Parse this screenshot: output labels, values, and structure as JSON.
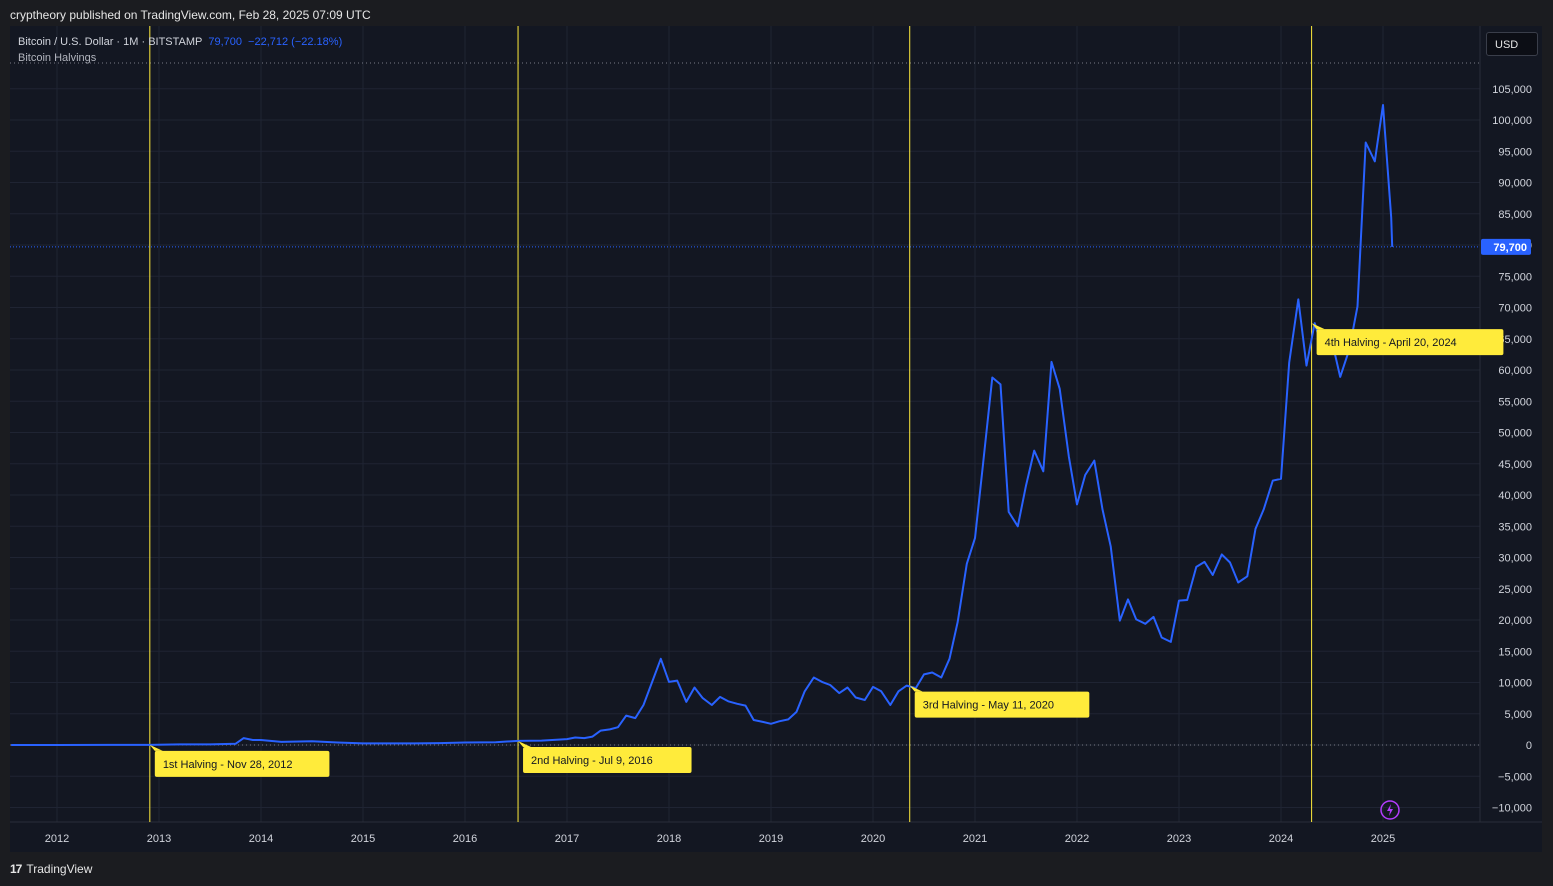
{
  "header": {
    "published": "cryptheory published on TradingView.com, Feb 28, 2025 07:09 UTC"
  },
  "legend": {
    "symbol": "Bitcoin / U.S. Dollar · 1M · BITSTAMP",
    "last": "79,700",
    "change": "−22,712 (−22.18%)",
    "indicator": "Bitcoin Halvings"
  },
  "currency_button": "USD",
  "footer": {
    "brand": "TradingView"
  },
  "colors": {
    "line": "#2962ff",
    "halving_line": "#ffeb3b",
    "label_bg": "#ffeb3b",
    "price_tag": "#2962ff"
  },
  "chart_data": {
    "type": "line",
    "x_ticks": [
      "2012",
      "2013",
      "2014",
      "2015",
      "2016",
      "2017",
      "2018",
      "2019",
      "2020",
      "2021",
      "2022",
      "2023",
      "2024",
      "2025"
    ],
    "y_ticks": [
      "105,000",
      "100,000",
      "95,000",
      "90,000",
      "85,000",
      "80,000",
      "75,000",
      "70,000",
      "65,000",
      "60,000",
      "55,000",
      "50,000",
      "45,000",
      "40,000",
      "35,000",
      "30,000",
      "25,000",
      "20,000",
      "15,000",
      "10,000",
      "5,000",
      "0",
      "−5,000",
      "−10,000"
    ],
    "ylim": [
      -12000,
      113000
    ],
    "last_price": {
      "value": 79700,
      "label": "79,700"
    },
    "halvings": [
      {
        "date": 2012.91,
        "label": "1st Halving - Nov 28, 2012"
      },
      {
        "date": 2016.52,
        "label": "2nd Halving - Jul 9, 2016"
      },
      {
        "date": 2020.36,
        "label": "3rd Halving - May 11, 2020"
      },
      {
        "date": 2024.3,
        "label": "4th Halving - April 20, 2024"
      }
    ],
    "series": [
      {
        "points": [
          [
            2011.55,
            5
          ],
          [
            2012.0,
            5
          ],
          [
            2012.5,
            10
          ],
          [
            2012.91,
            12
          ],
          [
            2013.2,
            100
          ],
          [
            2013.5,
            100
          ],
          [
            2013.75,
            200
          ],
          [
            2013.83,
            1100
          ],
          [
            2013.92,
            800
          ],
          [
            2014.0,
            800
          ],
          [
            2014.2,
            500
          ],
          [
            2014.5,
            600
          ],
          [
            2014.75,
            400
          ],
          [
            2015.0,
            250
          ],
          [
            2015.5,
            250
          ],
          [
            2015.75,
            300
          ],
          [
            2016.0,
            400
          ],
          [
            2016.3,
            450
          ],
          [
            2016.52,
            650
          ],
          [
            2016.75,
            700
          ],
          [
            2017.0,
            950
          ],
          [
            2017.08,
            1200
          ],
          [
            2017.17,
            1100
          ],
          [
            2017.25,
            1350
          ],
          [
            2017.33,
            2300
          ],
          [
            2017.42,
            2500
          ],
          [
            2017.5,
            2850
          ],
          [
            2017.58,
            4700
          ],
          [
            2017.67,
            4300
          ],
          [
            2017.75,
            6400
          ],
          [
            2017.83,
            9900
          ],
          [
            2017.92,
            13800
          ],
          [
            2018.0,
            10100
          ],
          [
            2018.08,
            10300
          ],
          [
            2018.17,
            6900
          ],
          [
            2018.25,
            9200
          ],
          [
            2018.33,
            7500
          ],
          [
            2018.42,
            6400
          ],
          [
            2018.5,
            7700
          ],
          [
            2018.58,
            7000
          ],
          [
            2018.67,
            6600
          ],
          [
            2018.75,
            6300
          ],
          [
            2018.83,
            4000
          ],
          [
            2018.92,
            3700
          ],
          [
            2019.0,
            3400
          ],
          [
            2019.08,
            3800
          ],
          [
            2019.17,
            4100
          ],
          [
            2019.25,
            5300
          ],
          [
            2019.33,
            8600
          ],
          [
            2019.42,
            10800
          ],
          [
            2019.5,
            10100
          ],
          [
            2019.58,
            9600
          ],
          [
            2019.67,
            8300
          ],
          [
            2019.75,
            9200
          ],
          [
            2019.83,
            7600
          ],
          [
            2019.92,
            7200
          ],
          [
            2020.0,
            9300
          ],
          [
            2020.08,
            8600
          ],
          [
            2020.17,
            6400
          ],
          [
            2020.25,
            8600
          ],
          [
            2020.33,
            9500
          ],
          [
            2020.42,
            9100
          ],
          [
            2020.5,
            11300
          ],
          [
            2020.58,
            11600
          ],
          [
            2020.67,
            10800
          ],
          [
            2020.75,
            13800
          ],
          [
            2020.83,
            19700
          ],
          [
            2020.92,
            29000
          ],
          [
            2021.0,
            33100
          ],
          [
            2021.08,
            45200
          ],
          [
            2021.17,
            58800
          ],
          [
            2021.25,
            57700
          ],
          [
            2021.33,
            37300
          ],
          [
            2021.42,
            35000
          ],
          [
            2021.5,
            41500
          ],
          [
            2021.58,
            47100
          ],
          [
            2021.67,
            43800
          ],
          [
            2021.75,
            61300
          ],
          [
            2021.83,
            57000
          ],
          [
            2021.92,
            46200
          ],
          [
            2022.0,
            38500
          ],
          [
            2022.08,
            43200
          ],
          [
            2022.17,
            45500
          ],
          [
            2022.25,
            37700
          ],
          [
            2022.33,
            31800
          ],
          [
            2022.42,
            19900
          ],
          [
            2022.5,
            23300
          ],
          [
            2022.58,
            20100
          ],
          [
            2022.67,
            19400
          ],
          [
            2022.75,
            20500
          ],
          [
            2022.83,
            17200
          ],
          [
            2022.92,
            16500
          ],
          [
            2023.0,
            23100
          ],
          [
            2023.08,
            23200
          ],
          [
            2023.17,
            28500
          ],
          [
            2023.25,
            29300
          ],
          [
            2023.33,
            27200
          ],
          [
            2023.42,
            30500
          ],
          [
            2023.5,
            29200
          ],
          [
            2023.58,
            26000
          ],
          [
            2023.67,
            27000
          ],
          [
            2023.75,
            34600
          ],
          [
            2023.83,
            37700
          ],
          [
            2023.92,
            42300
          ],
          [
            2024.0,
            42600
          ],
          [
            2024.08,
            61200
          ],
          [
            2024.17,
            71300
          ],
          [
            2024.25,
            60700
          ],
          [
            2024.33,
            67500
          ],
          [
            2024.42,
            62700
          ],
          [
            2024.5,
            64600
          ],
          [
            2024.58,
            58900
          ],
          [
            2024.67,
            63300
          ],
          [
            2024.75,
            70200
          ],
          [
            2024.83,
            96400
          ],
          [
            2024.92,
            93400
          ],
          [
            2025.0,
            102400
          ],
          [
            2025.08,
            84400
          ],
          [
            2025.09,
            79700
          ]
        ]
      }
    ]
  }
}
